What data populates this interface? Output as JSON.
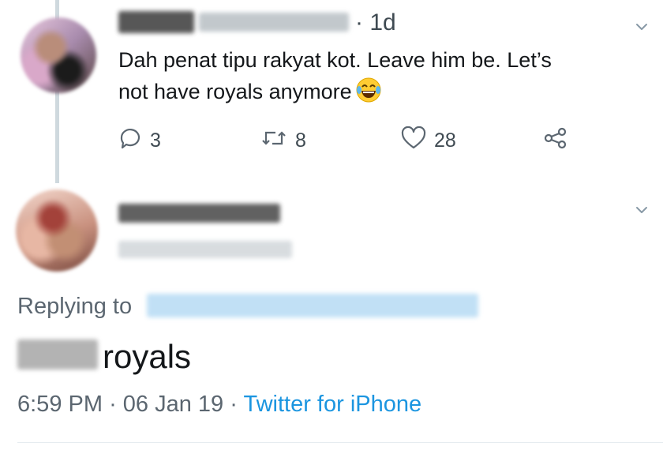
{
  "tweet1": {
    "time": "· 1d",
    "text_line1": "Dah penat tipu rakyat kot. Leave him be. Let’s",
    "text_line2": "not have royals anymore",
    "emoji": "face-with-tears-of-joy",
    "actions": {
      "reply_count": "3",
      "retweet_count": "8",
      "like_count": "28"
    }
  },
  "tweet2": {
    "replying_label": "Replying to",
    "text": "royals",
    "timestamp": "6:59 PM",
    "date": "06 Jan 19",
    "source": "Twitter for iPhone",
    "separator": "·"
  },
  "colors": {
    "text": "#14171a",
    "secondary": "#5b6670",
    "link": "#1b95e0",
    "thread_line": "#cfd9de"
  }
}
